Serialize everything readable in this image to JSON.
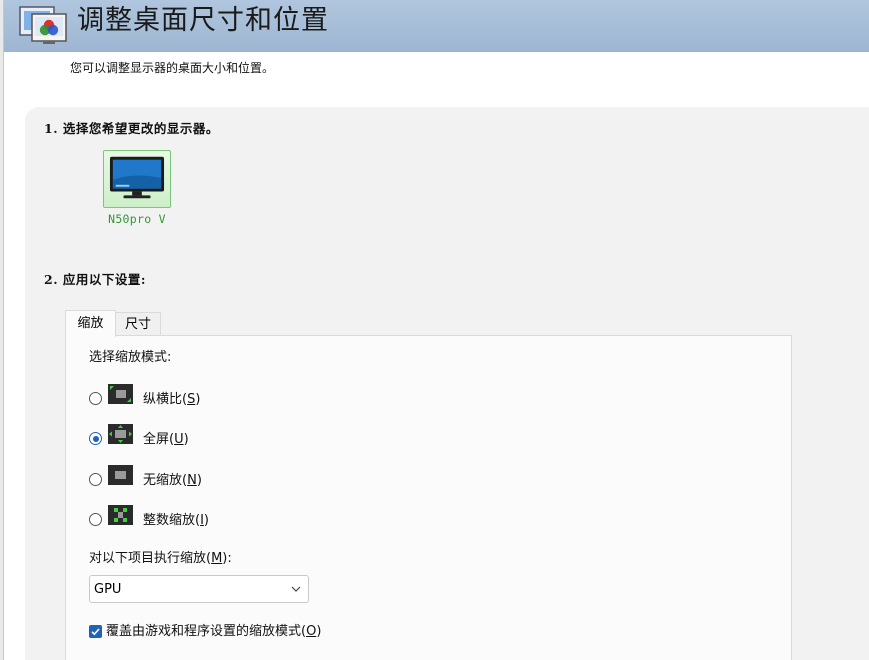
{
  "header": {
    "title": "调整桌面尺寸和位置"
  },
  "subtitle": "您可以调整显示器的桌面大小和位置。",
  "step1": {
    "heading": "1. 选择您希望更改的显示器。",
    "monitor_name": "N50pro V"
  },
  "step2": {
    "heading": "2. 应用以下设置:"
  },
  "tabs": [
    {
      "label": "缩放",
      "active": true
    },
    {
      "label": "尺寸",
      "active": false
    }
  ],
  "scaling": {
    "mode_label": "选择缩放模式:",
    "modes": [
      {
        "prefix": "纵横比(",
        "key": "S",
        "suffix": ")",
        "checked": false,
        "icon": "aspect-ratio-icon"
      },
      {
        "prefix": "全屏(",
        "key": "U",
        "suffix": ")",
        "checked": true,
        "icon": "fullscreen-icon"
      },
      {
        "prefix": "无缩放(",
        "key": "N",
        "suffix": ")",
        "checked": false,
        "icon": "no-scaling-icon"
      },
      {
        "prefix": "整数缩放(",
        "key": "I",
        "suffix": ")",
        "checked": false,
        "icon": "integer-scaling-icon"
      }
    ],
    "perform_label_prefix": "对以下项目执行缩放(",
    "perform_key": "M",
    "perform_label_suffix": "):",
    "perform_value": "GPU",
    "override": {
      "prefix": "覆盖由游戏和程序设置的缩放模式(",
      "key": "O",
      "suffix": ")",
      "checked": true
    }
  },
  "colors": {
    "accent": "#1e63b8",
    "titlebar": "#a8bfda",
    "monitor_label": "#2f9a2f"
  }
}
